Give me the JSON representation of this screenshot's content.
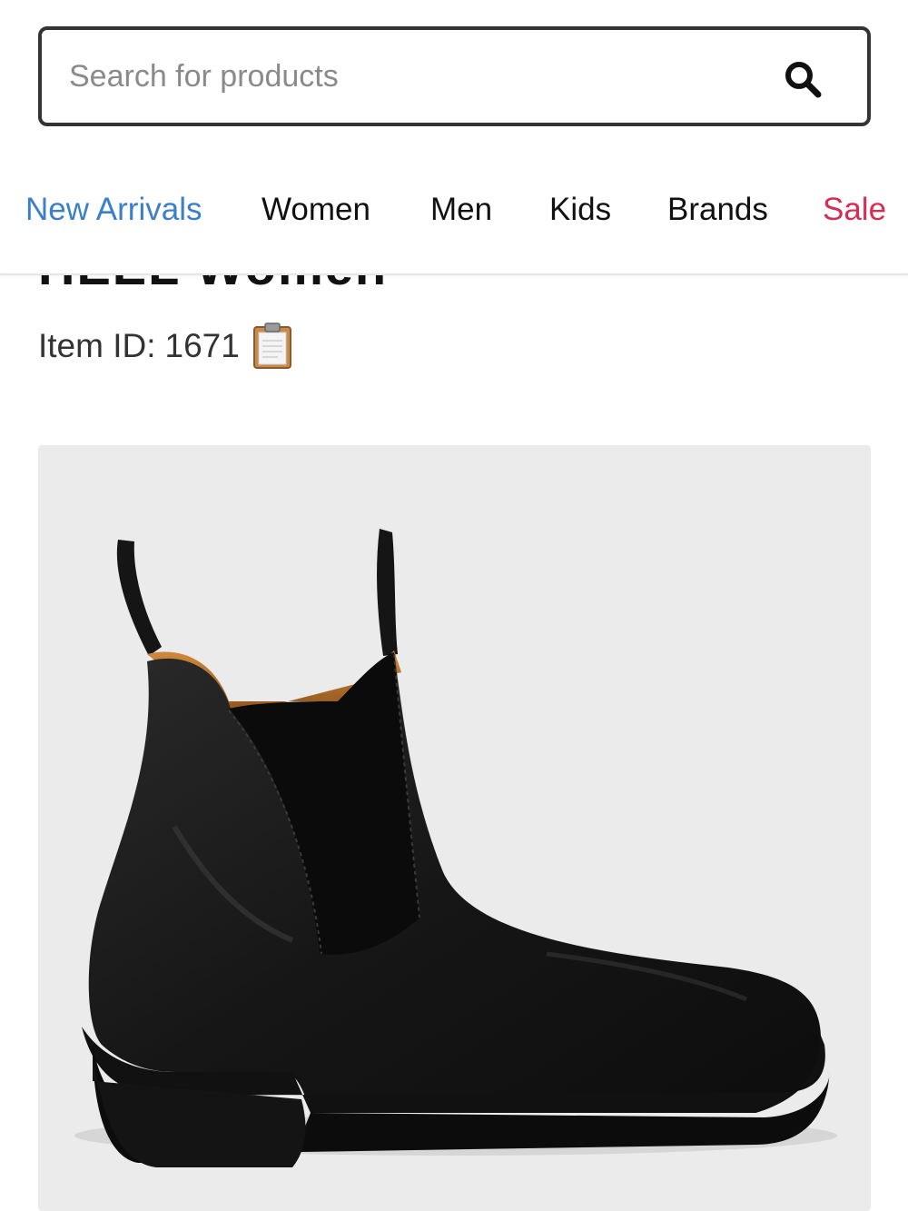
{
  "search": {
    "placeholder": "Search for products",
    "value": "",
    "icon": "search-icon"
  },
  "nav": {
    "items": [
      {
        "label": "New Arrivals",
        "color": "#3a7fc9"
      },
      {
        "label": "Women",
        "color": "#111111"
      },
      {
        "label": "Men",
        "color": "#111111"
      },
      {
        "label": "Kids",
        "color": "#111111"
      },
      {
        "label": "Brands",
        "color": "#111111"
      },
      {
        "label": "Sale",
        "color": "#d42e53"
      }
    ]
  },
  "product": {
    "title": "HEEL Women",
    "item_id_label": "Item ID:",
    "item_id": "1671",
    "copy_icon": "clipboard-icon",
    "image_description_icon": "product-photo-ankle-boot"
  }
}
